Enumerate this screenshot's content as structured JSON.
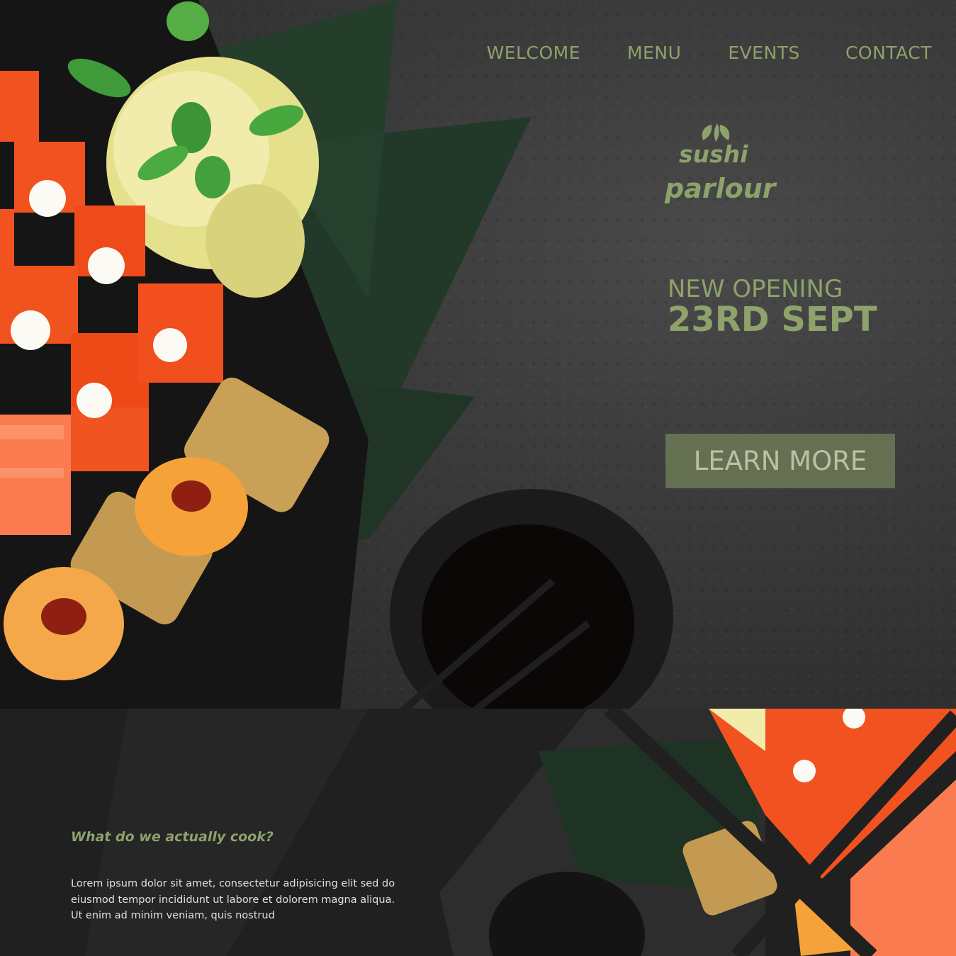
{
  "nav": {
    "items": [
      {
        "label": "WELCOME"
      },
      {
        "label": "MENU"
      },
      {
        "label": "EVENTS"
      },
      {
        "label": "CONTACT"
      }
    ]
  },
  "brand": {
    "line1": "sushi",
    "line2": "parlour",
    "icon": "leaf-icon",
    "accent": "#8ea26b"
  },
  "hero": {
    "announcement_line1": "NEW OPENING",
    "announcement_line2": "23RD SEPT",
    "cta_label": "LEARN MORE"
  },
  "about": {
    "heading": "What do we actually cook?",
    "body": "Lorem ipsum dolor sit amet, consectetur adipisicing elit sed do eiusmod tempor incididunt ut labore et dolorem magna aliqua. Ut enim ad minim veniam, quis nostrud"
  }
}
